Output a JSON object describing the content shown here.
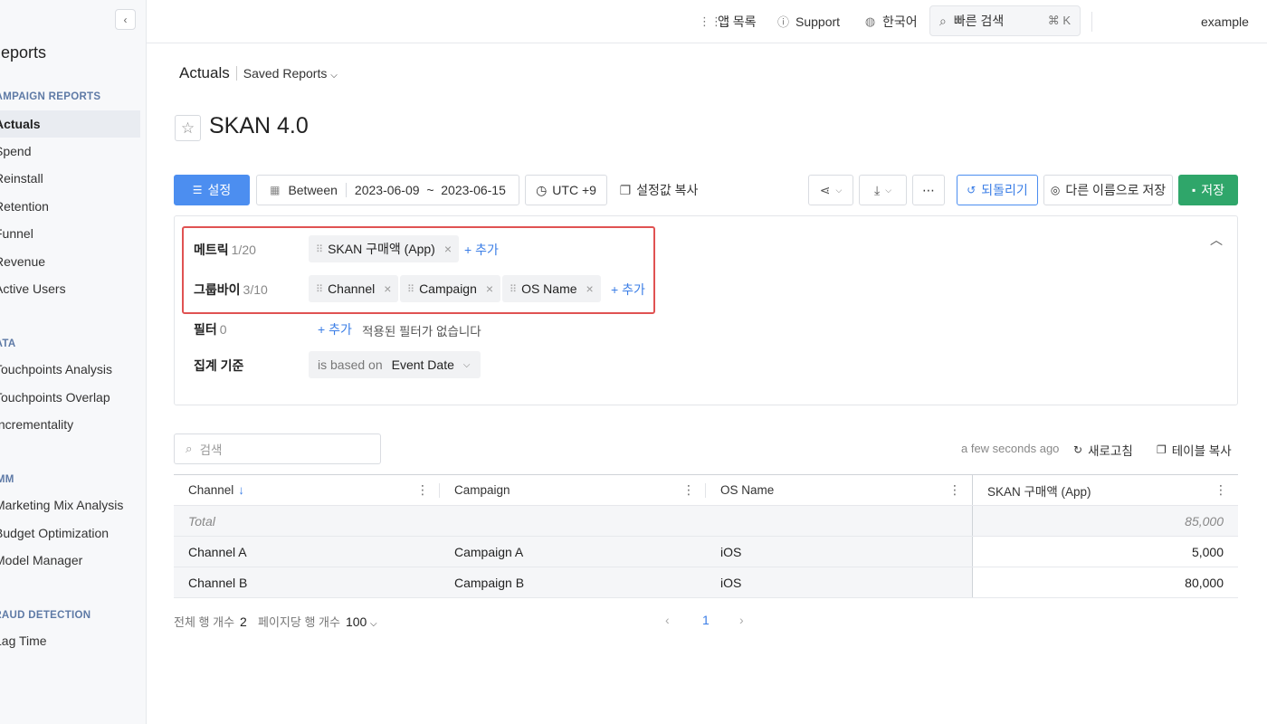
{
  "sidebar": {
    "title": "Reports",
    "collapse_icon": "‹",
    "sections": [
      {
        "label": "CAMPAIGN REPORTS",
        "items": [
          "Actuals",
          "Spend",
          "Reinstall",
          "Retention",
          "Funnel",
          "Revenue",
          "Active Users"
        ]
      },
      {
        "label": "DATA",
        "items": [
          "Touchpoints Analysis",
          "Touchpoints Overlap",
          "Incrementality"
        ]
      },
      {
        "label": "MMM",
        "items": [
          "Marketing Mix Analysis",
          "Budget Optimization",
          "Model Manager"
        ]
      },
      {
        "label": "FRAUD DETECTION",
        "items": [
          "Lag Time"
        ]
      }
    ]
  },
  "topbar": {
    "app_list": "앱 목록",
    "support": "Support",
    "language": "한국어",
    "search_label": "빠른 검색",
    "search_shortcut": "⌘ K",
    "user": "example"
  },
  "breadcrumb": {
    "main": "Actuals",
    "saved": "Saved Reports"
  },
  "page": {
    "title": "SKAN 4.0"
  },
  "toolbar": {
    "settings": "설정",
    "between": "Between",
    "date_range": "2023-06-09  ~  2023-06-15",
    "timezone": "UTC +9",
    "copy_settings": "설정값 복사",
    "revert": "되돌리기",
    "save_as": "다른 이름으로 저장",
    "save": "저장"
  },
  "settings_panel": {
    "metric_label": "메트릭",
    "metric_count": "1/20",
    "metrics": [
      "SKAN 구매액 (App)"
    ],
    "groupby_label": "그룹바이",
    "groupby_count": "3/10",
    "groupbys": [
      "Channel",
      "Campaign",
      "OS Name"
    ],
    "filter_label": "필터",
    "filter_count": "0",
    "no_filter": "적용된 필터가 없습니다",
    "agg_label": "집계 기준",
    "agg_prefix": "is based on",
    "agg_value": "Event Date",
    "add_label": "+ 추가"
  },
  "table": {
    "search_placeholder": "검색",
    "updated": "a few seconds ago",
    "refresh": "새로고침",
    "copy_table": "테이블 복사",
    "columns": [
      "Channel",
      "Campaign",
      "OS Name",
      "SKAN 구매액 (App)"
    ],
    "total": {
      "label": "Total",
      "value": "85,000"
    },
    "rows": [
      {
        "channel": "Channel A",
        "campaign": "Campaign A",
        "os": "iOS",
        "value": "5,000"
      },
      {
        "channel": "Channel B",
        "campaign": "Campaign B",
        "os": "iOS",
        "value": "80,000"
      }
    ]
  },
  "footer": {
    "total_rows_label": "전체 행 개수",
    "total_rows": "2",
    "per_page_label": "페이지당 행 개수",
    "per_page": "100",
    "current_page": "1"
  }
}
